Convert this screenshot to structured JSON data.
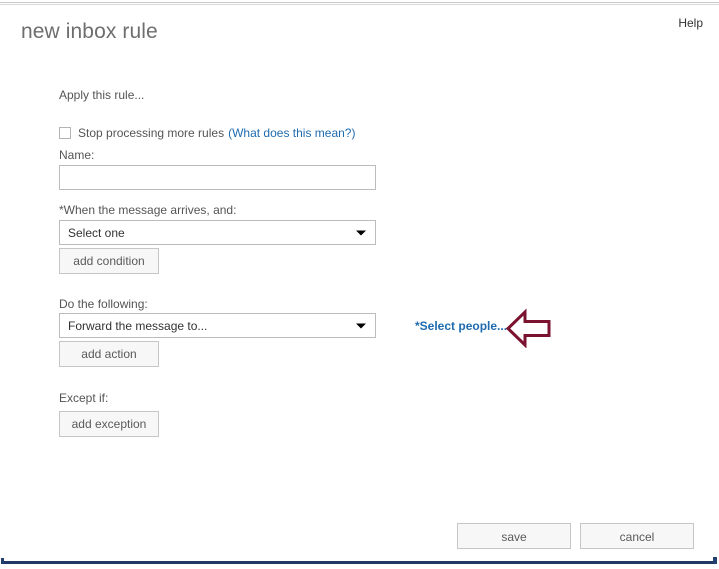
{
  "window": {
    "title": "new inbox rule",
    "help_label": "Help",
    "accent_link_color": "#1f6bb0",
    "annotation_arrow_color": "#7b1230",
    "frame_color": "#1f3864"
  },
  "form": {
    "apply_label": "Apply this rule...",
    "stop_processing": {
      "label": "Stop processing more rules",
      "checked": false,
      "help_link": "(What does this mean?)"
    },
    "name": {
      "label": "Name:",
      "value": "",
      "placeholder": ""
    },
    "condition": {
      "label": "*When the message arrives, and:",
      "selected": "Select one",
      "options": [
        "Select one"
      ],
      "add_button": "add condition"
    },
    "action": {
      "label": "Do the following:",
      "selected": "Forward the message to...",
      "options": [
        "Forward the message to..."
      ],
      "add_button": "add action",
      "select_people_link": "*Select people..."
    },
    "exception": {
      "label": "Except if:",
      "add_button": "add exception"
    }
  },
  "footer": {
    "save_label": "save",
    "cancel_label": "cancel"
  },
  "icons": {
    "caret": "chevron-down-icon",
    "arrow": "left-arrow-annotation-icon"
  }
}
